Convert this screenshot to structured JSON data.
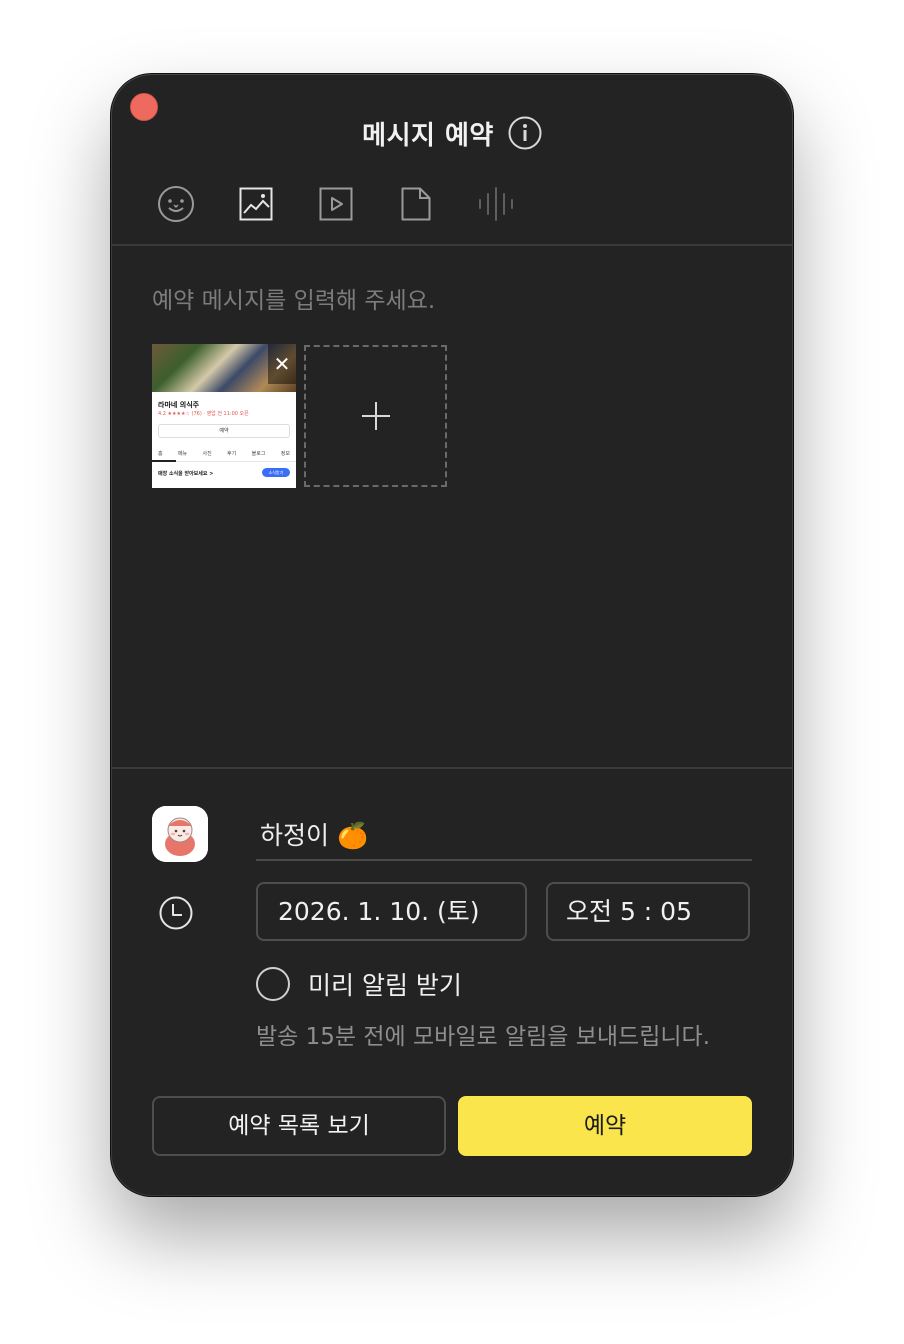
{
  "window": {
    "title": "메시지 예약"
  },
  "toolbar": {
    "icons": [
      "emoji-icon",
      "image-icon",
      "video-icon",
      "file-icon",
      "voice-icon"
    ]
  },
  "message": {
    "placeholder": "예약 메시지를 입력해 주세요."
  },
  "attachment": {
    "place_name": "라마네 의식주",
    "rating_text": "4.2 ★★★★☆ (76) · 영업 전 11:00 오픈",
    "button_text": "예약",
    "tabs": [
      "홈",
      "메뉴",
      "사진",
      "후기",
      "블로그",
      "정보"
    ],
    "footer_text": "매장 소식을 받아보세요 >",
    "pill_text": "소식받기",
    "remove_label": "✕",
    "add_label": "+"
  },
  "recipient": {
    "name": "하정이 🍊"
  },
  "schedule": {
    "date": "2026. 1. 10. (토)",
    "time": "오전 5 : 05"
  },
  "reminder": {
    "label": "미리 알림 받기",
    "help": "발송 15분 전에 모바일로 알림을 보내드립니다."
  },
  "actions": {
    "list_label": "예약 목록 보기",
    "reserve_label": "예약"
  },
  "colors": {
    "background": "#232323",
    "accent": "#fae54d",
    "close": "#ee6a5f"
  }
}
